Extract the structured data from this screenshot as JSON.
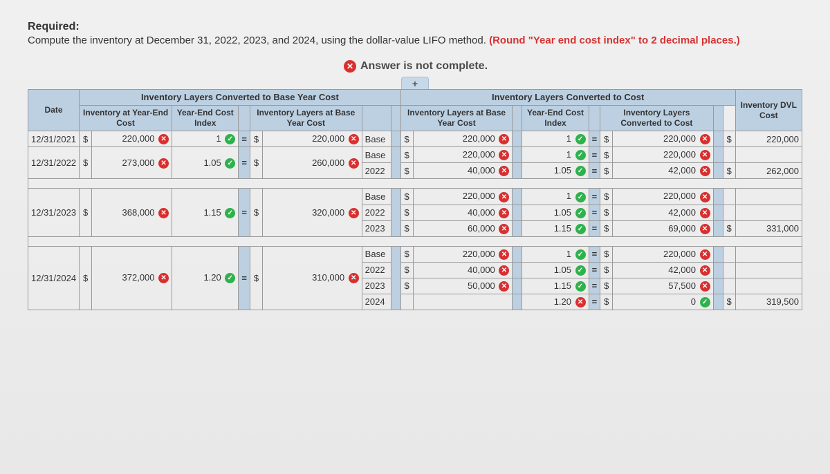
{
  "required": {
    "label": "Required:",
    "textA": "Compute the inventory at December 31, 2022, 2023, and 2024, using the dollar-value LIFO method. ",
    "textB_red": "(Round \"Year end cost index\" to 2 decimal places.)"
  },
  "banner": "Answer is not complete.",
  "headers": {
    "section_left": "Inventory Layers Converted to Base Year Cost",
    "section_right": "Inventory Layers Converted to Cost",
    "inventory_dvl": "Inventory DVL Cost",
    "date": "Date",
    "inv_yearend_cost": "Inventory at Year-End Cost",
    "yec_index": "Year-End Cost Index",
    "inv_layers_base": "Inventory Layers at Base Year Cost",
    "inv_layers_base2": "Inventory Layers at Base Year Cost",
    "yec_index2": "Year-End Cost Index",
    "inv_layers_converted": "Inventory Layers Converted to Cost",
    "layer": ""
  },
  "rows": [
    {
      "date": "12/31/2021",
      "inv_cost": "220,000",
      "inv_cost_m": "x",
      "idx": "1",
      "idx_m": "v",
      "base": "220,000",
      "base_m": "x",
      "layers": [
        {
          "name": "Base",
          "base": "220,000",
          "bm": "x",
          "idx": "1",
          "im": "v",
          "conv": "220,000",
          "cm": "x"
        }
      ],
      "total": "220,000"
    },
    {
      "date": "12/31/2022",
      "inv_cost": "273,000",
      "inv_cost_m": "x",
      "idx": "1.05",
      "idx_m": "v",
      "base": "260,000",
      "base_m": "x",
      "layers": [
        {
          "name": "Base",
          "base": "220,000",
          "bm": "x",
          "idx": "1",
          "im": "v",
          "conv": "220,000",
          "cm": "x"
        },
        {
          "name": "2022",
          "base": "40,000",
          "bm": "x",
          "idx": "1.05",
          "im": "v",
          "conv": "42,000",
          "cm": "x"
        }
      ],
      "total": "262,000"
    },
    {
      "date": "12/31/2023",
      "inv_cost": "368,000",
      "inv_cost_m": "x",
      "idx": "1.15",
      "idx_m": "v",
      "base": "320,000",
      "base_m": "x",
      "layers": [
        {
          "name": "Base",
          "base": "220,000",
          "bm": "x",
          "idx": "1",
          "im": "v",
          "conv": "220,000",
          "cm": "x"
        },
        {
          "name": "2022",
          "base": "40,000",
          "bm": "x",
          "idx": "1.05",
          "im": "v",
          "conv": "42,000",
          "cm": "x"
        },
        {
          "name": "2023",
          "base": "60,000",
          "bm": "x",
          "idx": "1.15",
          "im": "v",
          "conv": "69,000",
          "cm": "x"
        }
      ],
      "total": "331,000"
    },
    {
      "date": "12/31/2024",
      "inv_cost": "372,000",
      "inv_cost_m": "x",
      "idx": "1.20",
      "idx_m": "v",
      "base": "310,000",
      "base_m": "x",
      "layers": [
        {
          "name": "Base",
          "base": "220,000",
          "bm": "x",
          "idx": "1",
          "im": "v",
          "conv": "220,000",
          "cm": "x"
        },
        {
          "name": "2022",
          "base": "40,000",
          "bm": "x",
          "idx": "1.05",
          "im": "v",
          "conv": "42,000",
          "cm": "x"
        },
        {
          "name": "2023",
          "base": "50,000",
          "bm": "x",
          "idx": "1.15",
          "im": "v",
          "conv": "57,500",
          "cm": "x"
        },
        {
          "name": "2024",
          "base": "",
          "bm": "",
          "idx": "1.20",
          "im": "x",
          "conv": "0",
          "cm": "v"
        }
      ],
      "total": "319,500"
    }
  ]
}
